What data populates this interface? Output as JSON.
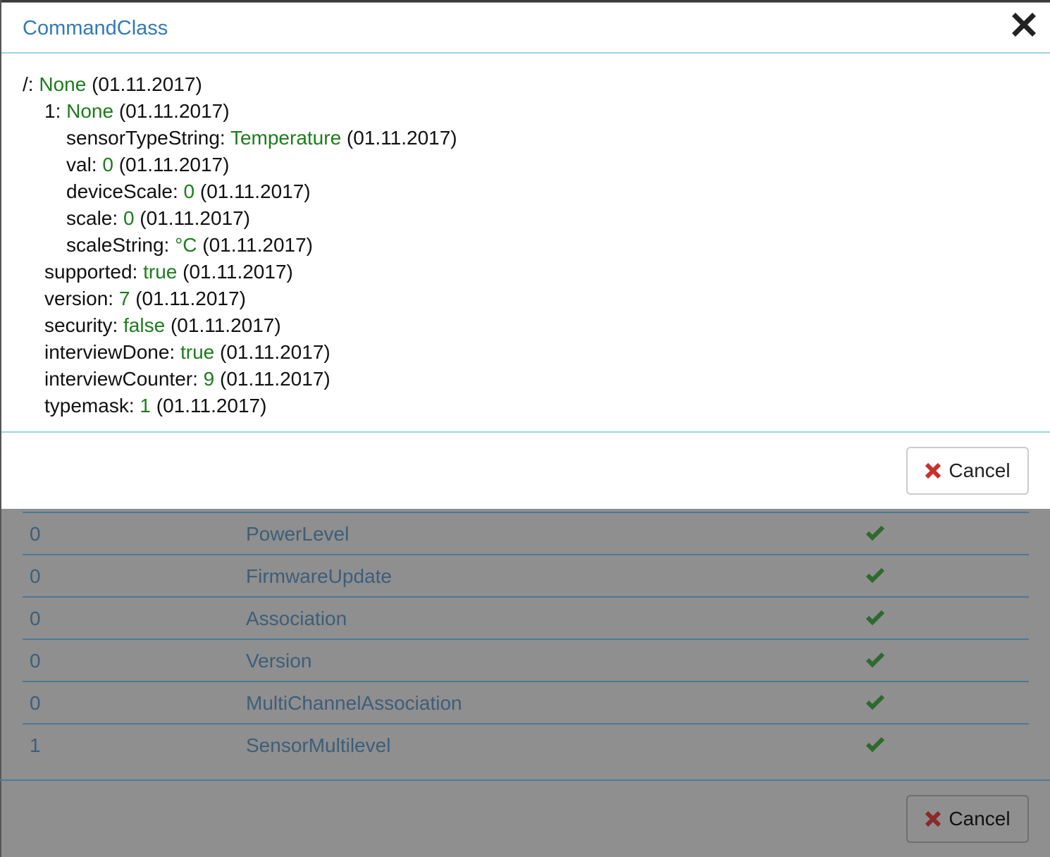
{
  "modal": {
    "title": "CommandClass",
    "tree": [
      {
        "key": "/:",
        "value": "None",
        "date": "(01.11.2017)",
        "level": 0
      },
      {
        "key": "1:",
        "value": "None",
        "date": "(01.11.2017)",
        "level": 1
      },
      {
        "key": "sensorTypeString:",
        "value": "Temperature",
        "date": "(01.11.2017)",
        "level": 2
      },
      {
        "key": "val:",
        "value": "0",
        "date": "(01.11.2017)",
        "level": 2
      },
      {
        "key": "deviceScale:",
        "value": "0",
        "date": "(01.11.2017)",
        "level": 2
      },
      {
        "key": "scale:",
        "value": "0",
        "date": "(01.11.2017)",
        "level": 2
      },
      {
        "key": "scaleString:",
        "value": "°C",
        "date": "(01.11.2017)",
        "level": 2
      },
      {
        "key": "supported:",
        "value": "true",
        "date": "(01.11.2017)",
        "level": 1
      },
      {
        "key": "version:",
        "value": "7",
        "date": "(01.11.2017)",
        "level": 1
      },
      {
        "key": "security:",
        "value": "false",
        "date": "(01.11.2017)",
        "level": 1
      },
      {
        "key": "interviewDone:",
        "value": "true",
        "date": "(01.11.2017)",
        "level": 1
      },
      {
        "key": "interviewCounter:",
        "value": "9",
        "date": "(01.11.2017)",
        "level": 1
      },
      {
        "key": "typemask:",
        "value": "1",
        "date": "(01.11.2017)",
        "level": 1
      }
    ],
    "cancel_label": "Cancel",
    "close_icon": "close-icon",
    "cancel_icon": "x-icon"
  },
  "background": {
    "rows": [
      {
        "id": "0",
        "name": "PowerLevel",
        "icon": "check-icon"
      },
      {
        "id": "0",
        "name": "FirmwareUpdate",
        "icon": "check-icon"
      },
      {
        "id": "0",
        "name": "Association",
        "icon": "check-icon"
      },
      {
        "id": "0",
        "name": "Version",
        "icon": "check-icon"
      },
      {
        "id": "0",
        "name": "MultiChannelAssociation",
        "icon": "check-icon"
      },
      {
        "id": "1",
        "name": "SensorMultilevel",
        "icon": "check-icon"
      }
    ],
    "cancel_label": "Cancel"
  },
  "colors": {
    "title": "#337ab7",
    "value_green": "#1b7d1b",
    "cancel_x_red": "#c9302c",
    "check_green": "#2d6a2d",
    "divider": "#9ed3e6"
  }
}
